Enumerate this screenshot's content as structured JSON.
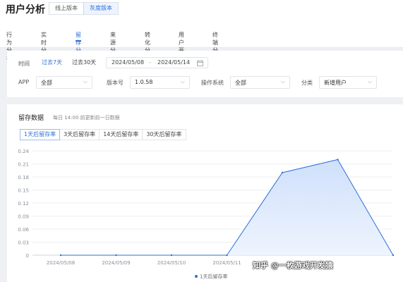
{
  "header": {
    "title": "用户分析",
    "version_toggle": [
      "线上版本",
      "灰度版本"
    ],
    "tabs": [
      "行为分析",
      "实时分析",
      "留存分析",
      "来源分析",
      "转化分析",
      "用户画像",
      "终端分析"
    ],
    "active_tab": "留存分析"
  },
  "filters": {
    "time_label": "时间",
    "quick_ranges": [
      "过去7天",
      "过去30天"
    ],
    "start_date": "2024/05/08",
    "date_separator": "-",
    "end_date": "2024/05/14",
    "app_label": "APP",
    "app_value": "全部",
    "version_label": "版本号",
    "version_value": "1.0.58",
    "os_label": "操作系统",
    "os_value": "全部",
    "category_label": "分类",
    "category_value": "新增用户"
  },
  "chart_section": {
    "title": "留存数据",
    "note": "每日 14:00 前更新前一日数据",
    "metric_tabs": [
      "1天后留存率",
      "3天后留存率",
      "14天后留存率",
      "30天后留存率"
    ]
  },
  "chart_data": {
    "type": "area",
    "x": [
      "2024/05/08",
      "2024/05/09",
      "2024/05/10",
      "2024/05/11",
      "2024/05/12",
      "2024/05/13",
      "2024/05/14"
    ],
    "x_tick_labels": [
      "2024/05/08",
      "2024/05/09",
      "2024/05/10",
      "2024/05/11"
    ],
    "series": [
      {
        "name": "1天后留存率",
        "values": [
          0,
          0,
          0,
          0,
          0.19,
          0.22,
          0
        ]
      }
    ],
    "ylim": [
      0,
      0.24
    ],
    "y_ticks": [
      "0",
      "0.03",
      "0.06",
      "0.09",
      "0.12",
      "0.15",
      "0.18",
      "0.21",
      "0.24"
    ],
    "grid": true,
    "legend": "bottom",
    "color": "#2f6fd6"
  },
  "watermark": "知乎 @一枚游戏开发猿"
}
